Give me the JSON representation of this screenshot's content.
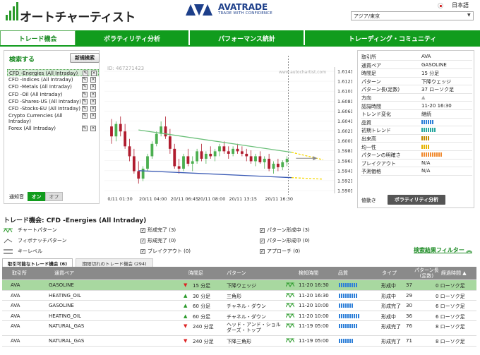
{
  "header": {
    "app_name": "オートチャーティスト",
    "broker_name": "AVATRADE",
    "broker_tagline": "TRADE WITH CONFIDENCE",
    "language": "日本語",
    "timezone": "アジア/東京"
  },
  "nav": {
    "tabs": [
      {
        "label": "トレード機会",
        "active": true
      },
      {
        "label": "ボラティリティ分析",
        "active": false
      },
      {
        "label": "パフォーマンス統計",
        "active": false
      },
      {
        "label": "トレーディング・コミュニティ",
        "active": false
      }
    ]
  },
  "search": {
    "title": "検索する",
    "new_search_label": "新規検索",
    "items": [
      "CFD -Energies (All Intraday)",
      "CFD -Indices (All Intraday)",
      "CFD -Metals (All Intraday)",
      "CFD -Oil (All Intraday)",
      "CFD -Shares-US (All Intraday)",
      "CFD -Stocks-EU (All Intraday)",
      "Crypto Currencies (All Intraday)",
      "Forex (All Intraday)"
    ],
    "notify_label": "通知音",
    "toggle_on": "オン",
    "toggle_off": "オフ"
  },
  "chart": {
    "id_label": "ID: 467271423",
    "watermark": "www.autochartist.com",
    "y_ticks": [
      "1.6141",
      "1.6121",
      "1.6101",
      "1.6081",
      "1.6061",
      "1.6041",
      "1.6021",
      "1.6001",
      "1.5981",
      "1.5961",
      "1.5941",
      "1.5921",
      "1.5901"
    ],
    "x_ticks": [
      "0/11 01:30",
      "20/11 04:00",
      "20/11 06:45",
      "20/11 08:00",
      "20/11 13:15",
      "20/11 16:30"
    ]
  },
  "chart_data": {
    "type": "candlestick",
    "ylim": [
      1.5901,
      1.6141
    ],
    "candles": [
      [
        1.603,
        1.6045,
        1.5995,
        1.601
      ],
      [
        1.601,
        1.604,
        1.6,
        1.6035
      ],
      [
        1.6035,
        1.605,
        1.601,
        1.602
      ],
      [
        1.602,
        1.6035,
        1.5985,
        1.599
      ],
      [
        1.599,
        1.6005,
        1.596,
        1.597
      ],
      [
        1.597,
        1.5985,
        1.5935,
        1.594
      ],
      [
        1.594,
        1.596,
        1.5915,
        1.5925
      ],
      [
        1.5925,
        1.595,
        1.592,
        1.5945
      ],
      [
        1.5945,
        1.5975,
        1.594,
        1.597
      ],
      [
        1.597,
        1.6,
        1.5965,
        1.5995
      ],
      [
        1.5995,
        1.602,
        1.599,
        1.6015
      ],
      [
        1.6015,
        1.604,
        1.601,
        1.603
      ],
      [
        1.603,
        1.605,
        1.6005,
        1.601
      ],
      [
        1.601,
        1.6025,
        1.5975,
        1.5985
      ],
      [
        1.5985,
        1.5995,
        1.5945,
        1.595
      ],
      [
        1.595,
        1.5965,
        1.5935,
        1.5945
      ],
      [
        1.5945,
        1.5975,
        1.594,
        1.597
      ],
      [
        1.597,
        1.5985,
        1.595,
        1.5955
      ],
      [
        1.5955,
        1.597,
        1.594,
        1.596
      ],
      [
        1.596,
        1.5985,
        1.5955,
        1.598
      ],
      [
        1.598,
        1.5995,
        1.596,
        1.5965
      ],
      [
        1.5965,
        1.598,
        1.5955,
        1.5975
      ],
      [
        1.5975,
        1.599,
        1.5965,
        1.597
      ],
      [
        1.597,
        1.5985,
        1.596,
        1.598
      ],
      [
        1.598,
        1.5995,
        1.597,
        1.599
      ],
      [
        1.599,
        1.6,
        1.5975,
        1.598
      ],
      [
        1.598,
        1.599,
        1.5965,
        1.5975
      ],
      [
        1.5975,
        1.599,
        1.597,
        1.5985
      ],
      [
        1.5985,
        1.5995,
        1.5975,
        1.598
      ],
      [
        1.598,
        1.599,
        1.597,
        1.5975
      ],
      [
        1.5975,
        1.5985,
        1.596,
        1.597
      ],
      [
        1.597,
        1.5982,
        1.5955,
        1.596
      ],
      [
        1.596,
        1.5975,
        1.595,
        1.597
      ],
      [
        1.597,
        1.598,
        1.5955,
        1.5958
      ],
      [
        1.5958,
        1.597,
        1.5945,
        1.5965
      ],
      [
        1.5965,
        1.5975,
        1.594,
        1.5945
      ],
      [
        1.5945,
        1.596,
        1.5935,
        1.5955
      ],
      [
        1.5955,
        1.5965,
        1.594,
        1.5948
      ],
      [
        1.5948,
        1.5962,
        1.5942,
        1.5958
      ],
      [
        1.5958,
        1.597,
        1.595,
        1.5965
      ]
    ],
    "resistance_line": {
      "from": [
        6,
        1.6023
      ],
      "to": [
        40,
        1.5978
      ]
    },
    "support_line": {
      "from": [
        6,
        1.5941
      ],
      "to": [
        40,
        1.5927
      ]
    },
    "projection_upper": {
      "from": [
        40,
        1.5978
      ],
      "to": [
        47,
        1.5963
      ]
    },
    "projection_lower": {
      "from": [
        40,
        1.5927
      ],
      "to": [
        47,
        1.5924
      ]
    }
  },
  "info": {
    "rows": [
      {
        "k": "取引所",
        "v": "AVA"
      },
      {
        "k": "通貨ペア",
        "v": "GASOLINE"
      },
      {
        "k": "時間足",
        "v": "15 分足"
      },
      {
        "k": "パターン",
        "v": "下降ウェッジ"
      },
      {
        "k": "パターン長(足数)",
        "v": "37 ローソク足"
      },
      {
        "k": "方向",
        "v": ""
      },
      {
        "k": "認識時間",
        "v": "11-20 16:30"
      },
      {
        "k": "トレンド変化",
        "v": "継続"
      },
      {
        "k": "品質",
        "v": "",
        "bars": 6,
        "color": "#2d7fd8"
      },
      {
        "k": "初期トレンド",
        "v": "",
        "bars": 7,
        "color": "#2aa8a0"
      },
      {
        "k": "出来高",
        "v": "",
        "bars": 4,
        "color": "#c08a00"
      },
      {
        "k": "均一性",
        "v": "",
        "bars": 4,
        "color": "#e5b400"
      },
      {
        "k": "パターンの明確さ",
        "v": "",
        "bars": 10,
        "color": "#f08a30"
      },
      {
        "k": "ブレイクアウト",
        "v": "N/A"
      },
      {
        "k": "予測価格",
        "v": "N/A"
      }
    ],
    "vol_label": "値動き",
    "vol_button": "ボラティリティ分析"
  },
  "opportunities": {
    "title": "トレード機会: CFD -Energies (All Intraday)",
    "legend": [
      {
        "label": "チャートパターン"
      },
      {
        "label": "フィボナッチパターン"
      },
      {
        "label": "キーレベル"
      }
    ],
    "filters_mid": [
      "形成完了 (3)",
      "形成完了 (0)",
      "ブレイクアウト (0)"
    ],
    "filters_right": [
      "パターン形成中 (3)",
      "パターン形成中 (0)",
      "アプローチ (0)"
    ],
    "filter_link": "検索結果フィルター",
    "tab_active": "取引可能なトレード機会 (6)",
    "tab_inactive": "期限切れのトレード機会 (294)",
    "columns": [
      "取引所",
      "通貨ペア",
      "時間足",
      "パターン",
      "検知時間",
      "品質",
      "タイプ",
      "パターン長\n(足数)",
      "経過時間"
    ],
    "column_lines": [
      [
        "取引所"
      ],
      [
        "通貨ペア"
      ],
      [
        "時間足"
      ],
      [
        "パターン"
      ],
      [
        "検知時間"
      ],
      [
        "品質"
      ],
      [
        "タイプ"
      ],
      [
        "パターン長",
        "(足数)"
      ],
      [
        "経過時間 ▲"
      ]
    ],
    "rows": [
      {
        "ex": "AVA",
        "sym": "GASOLINE",
        "dir": "down",
        "tf": "15 分足",
        "pat": "下降ウェッジ",
        "time": "11-20 16:30",
        "q": 9,
        "type": "形成中",
        "len": "37",
        "age": "0 ローソク足",
        "sel": true
      },
      {
        "ex": "AVA",
        "sym": "HEATING_OIL",
        "dir": "up",
        "tf": "30 分足",
        "pat": "三角形",
        "time": "11-20 16:30",
        "q": 9,
        "type": "形成中",
        "len": "29",
        "age": "0 ローソク足",
        "sel": false
      },
      {
        "ex": "AVA",
        "sym": "GASOLINE",
        "dir": "up",
        "tf": "60 分足",
        "pat": "チャネル・ダウン",
        "time": "11-20 10:00",
        "q": 7,
        "type": "形成完了",
        "len": "30",
        "age": "6 ローソク足",
        "sel": false
      },
      {
        "ex": "AVA",
        "sym": "HEATING_OIL",
        "dir": "up",
        "tf": "60 分足",
        "pat": "チャネル・ダウン",
        "time": "11-20 10:00",
        "q": 10,
        "type": "形成中",
        "len": "36",
        "age": "6 ローソク足",
        "sel": false
      },
      {
        "ex": "AVA",
        "sym": "NATURAL_GAS",
        "dir": "down",
        "tf": "240 分足",
        "pat": "ヘッド・アンド・ショルダーズ・トップ",
        "time": "11-19 05:00",
        "q": 9,
        "type": "形成完了",
        "len": "76",
        "age": "8 ローソク足",
        "sel": false
      },
      {
        "ex": "AVA",
        "sym": "NATURAL_GAS",
        "dir": "down",
        "tf": "240 分足",
        "pat": "下降三角形",
        "time": "11-19 05:00",
        "q": 7,
        "type": "形成完了",
        "len": "71",
        "age": "8 ローソク足",
        "sel": false
      }
    ]
  }
}
